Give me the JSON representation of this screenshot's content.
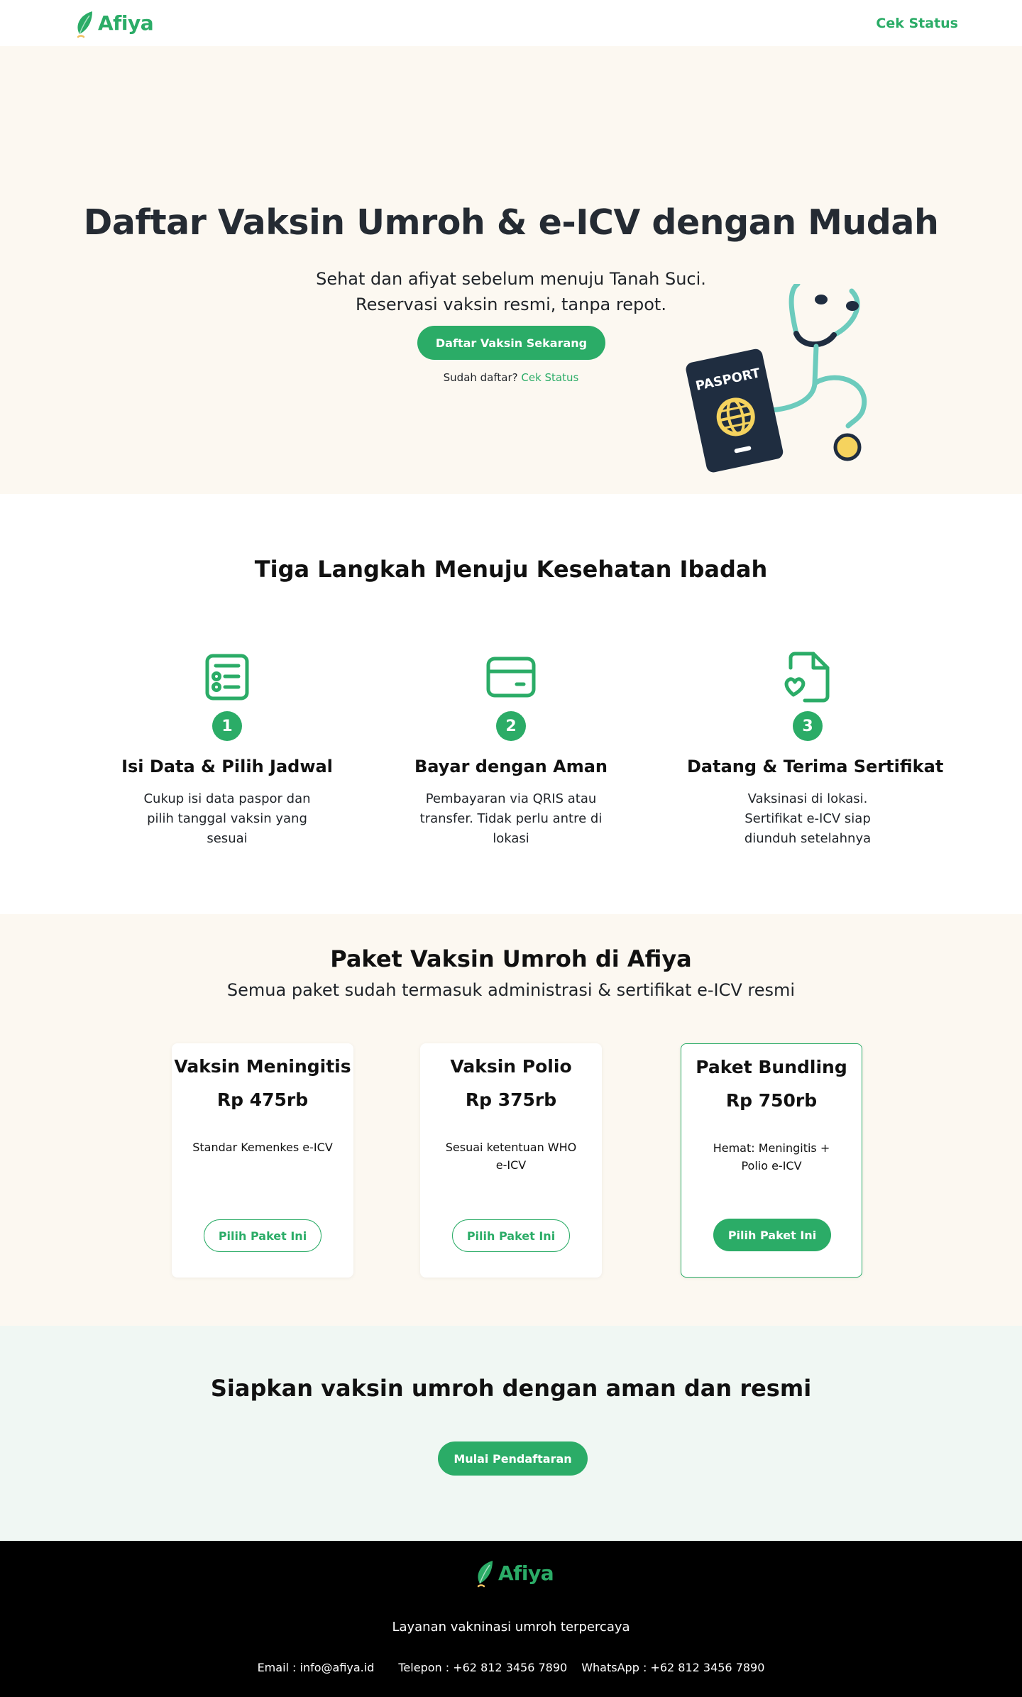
{
  "brand": {
    "name": "Afiya"
  },
  "nav": {
    "cek_status": "Cek Status"
  },
  "hero": {
    "title": "Daftar Vaksin Umroh & e-ICV dengan Mudah",
    "subtitle_line1": "Sehat dan afiyat sebelum menuju Tanah Suci.",
    "subtitle_line2": "Reservasi vaksin resmi, tanpa repot.",
    "cta": "Daftar Vaksin Sekarang",
    "note_prefix": "Sudah daftar?",
    "note_link": "Cek Status",
    "passport_label": "PASPORT"
  },
  "steps": {
    "title": "Tiga Langkah Menuju Kesehatan Ibadah",
    "items": [
      {
        "num": "1",
        "icon": "form-list-icon",
        "title": "Isi Data & Pilih Jadwal",
        "desc": "Cukup isi data paspor dan pilih tanggal vaksin yang sesuai"
      },
      {
        "num": "2",
        "icon": "credit-card-icon",
        "title": "Bayar dengan Aman",
        "desc": "Pembayaran via QRIS atau transfer. Tidak perlu antre di lokasi"
      },
      {
        "num": "3",
        "icon": "document-heart-icon",
        "title": "Datang & Terima Sertifikat",
        "desc": "Vaksinasi di lokasi. Sertifikat e-ICV siap diunduh setelahnya"
      }
    ]
  },
  "packages": {
    "title": "Paket Vaksin Umroh di Afiya",
    "subtitle": "Semua paket sudah termasuk administrasi & sertifikat e-ICV resmi",
    "items": [
      {
        "name": "Vaksin Meningitis",
        "price": "Rp 475rb",
        "desc": "Standar Kemenkes e-ICV",
        "cta": "Pilih Paket Ini",
        "featured": false
      },
      {
        "name": "Vaksin Polio",
        "price": "Rp 375rb",
        "desc": "Sesuai ketentuan WHO e-ICV",
        "cta": "Pilih Paket Ini",
        "featured": false
      },
      {
        "name": "Paket Bundling",
        "price": "Rp 750rb",
        "desc": "Hemat: Meningitis + Polio e-ICV",
        "cta": "Pilih Paket Ini",
        "featured": true
      }
    ]
  },
  "cta_band": {
    "title": "Siapkan vaksin umroh dengan aman dan resmi",
    "button": "Mulai Pendaftaran"
  },
  "footer": {
    "tagline": "Layanan vakninasi umroh terpercaya",
    "email": "Email : info@afiya.id",
    "phone": "Telepon : +62 812 3456 7890",
    "whatsapp": "WhatsApp : +62 812 3456 7890"
  },
  "colors": {
    "accent": "#2bac67",
    "cream": "#fcf8f1",
    "mint": "#f0f7f3",
    "navy": "#1f2d40",
    "teal": "#6ccbbd",
    "yellow": "#f5d35e"
  }
}
